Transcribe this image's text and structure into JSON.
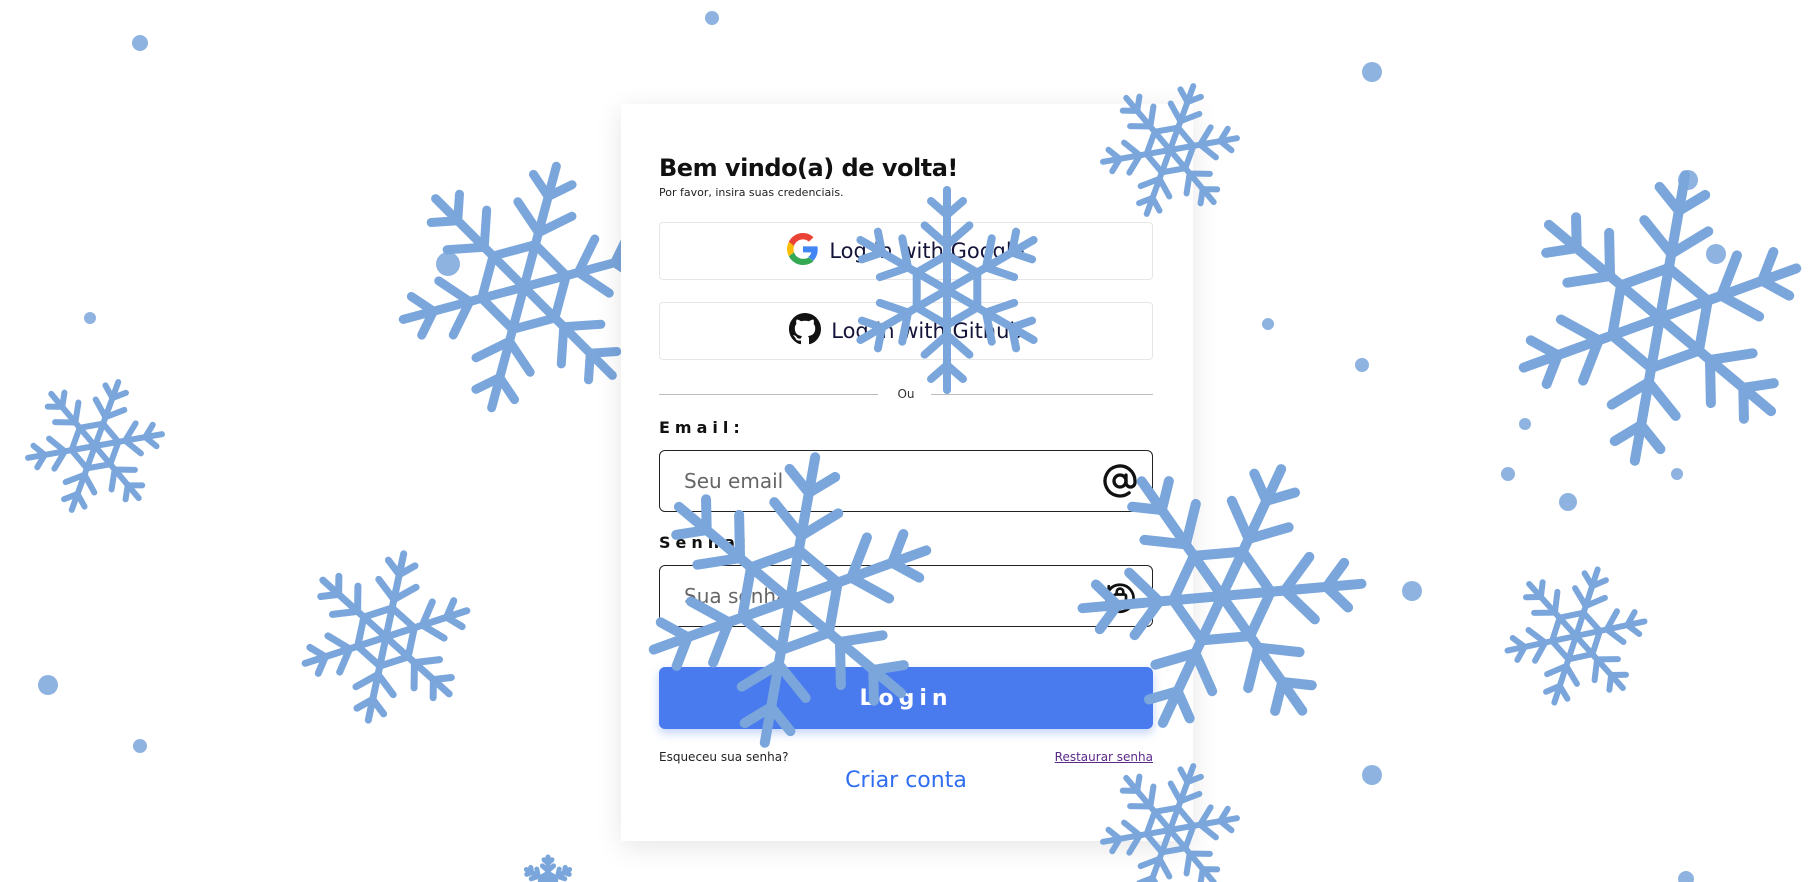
{
  "colors": {
    "snow": "#7aa6dc",
    "primary": "#4a7bee",
    "link": "#2f6ef0",
    "visited_link": "#5a2a8a"
  },
  "header": {
    "title": "Bem vindo(a) de volta!",
    "subtitle": "Por favor, insira suas credenciais."
  },
  "oauth": {
    "google_label": "Log in with Google",
    "google_icon": "google-logo-icon",
    "github_label": "Log in with Github",
    "github_icon": "github-logo-icon"
  },
  "divider": {
    "text": "Ou"
  },
  "email": {
    "label": "Email:",
    "placeholder": "Seu email",
    "value": "",
    "icon": "at-sign-icon"
  },
  "password": {
    "label": "Senha:",
    "placeholder": "Sua senha",
    "value": "",
    "icon": "lock-rotate-icon"
  },
  "login_button": "Login",
  "footer": {
    "forgot_text": "Esqueceu sua senha?",
    "restore_link": "Restaurar senha",
    "create_account": "Criar conta"
  }
}
